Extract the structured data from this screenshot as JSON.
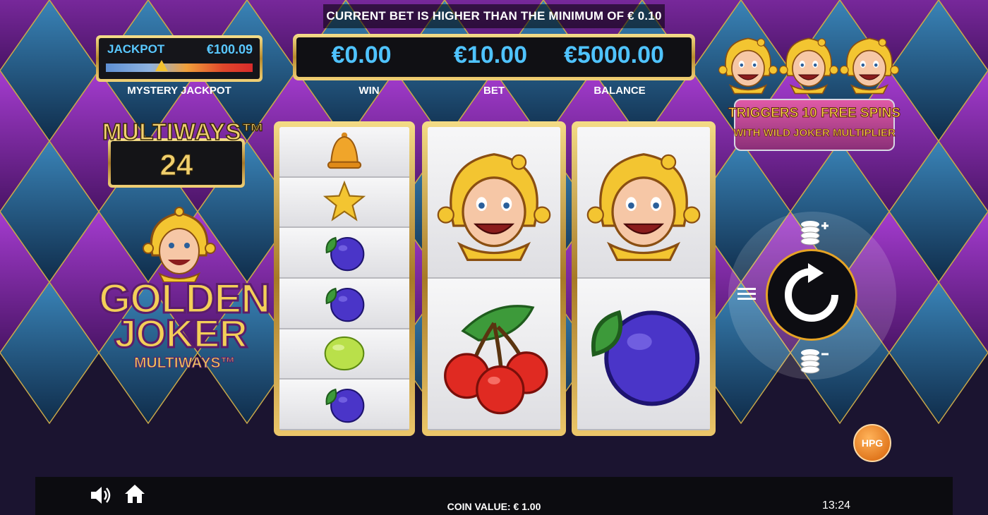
{
  "notice": "CURRENT BET IS HIGHER THAN THE MINIMUM OF € 0.10",
  "jackpot": {
    "label": "JACKPOT",
    "value": "€100.09",
    "caption": "MYSTERY JACKPOT",
    "progress": 0.38
  },
  "stats": {
    "win": {
      "value": "€0.00",
      "label": "WIN"
    },
    "bet": {
      "value": "€10.00",
      "label": "BET"
    },
    "balance": {
      "value": "€5000.00",
      "label": "BALANCE"
    }
  },
  "multiways": {
    "title": "MULTIWAYS™",
    "count": "24"
  },
  "logo": {
    "line1": "GOLDEN",
    "line2": "JOKER",
    "line3": "MULTIWAYS™"
  },
  "reels": [
    [
      "bell",
      "star",
      "plum",
      "plum",
      "lime",
      "plum"
    ],
    [
      "joker",
      "cherry"
    ],
    [
      "joker",
      "plum"
    ]
  ],
  "promo": {
    "line1": "TRIGGERS 10 FREE SPINS",
    "line2": "WITH WILD JOKER MULTIPLIER",
    "scatter_icons": [
      "joker-icon",
      "joker-icon",
      "joker-icon"
    ]
  },
  "controls": {
    "spin_icon": "spin-refresh-icon",
    "menu_icon": "hamburger-menu-icon",
    "bet_up_icon": "coins-plus-icon",
    "bet_down_icon": "coins-minus-icon"
  },
  "provider": "HPG",
  "bottom": {
    "coin_value": "COIN VALUE: € 1.00",
    "time": "13:24",
    "sound_icon": "speaker-icon",
    "home_icon": "home-icon"
  },
  "colors": {
    "accent_blue": "#4fc3ff",
    "gold": "#f3cf58",
    "spin_border": "#e6a425"
  }
}
